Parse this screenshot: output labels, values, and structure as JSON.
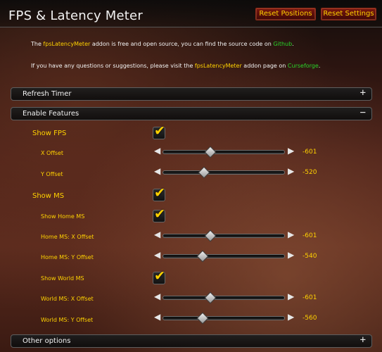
{
  "header": {
    "title": "FPS & Latency Meter",
    "reset_positions_label": "Reset Positions",
    "reset_settings_label": "Reset Settings"
  },
  "intro": {
    "line1_pre": "The ",
    "line1_addon": "fpsLatencyMeter",
    "line1_mid": " addon is free and open source, you can find the source code on ",
    "line1_link": "Github",
    "line1_end": ".",
    "line2_pre": "If you have any questions or suggestions, please visit the ",
    "line2_addon": "fpsLatencyMeter",
    "line2_mid": " addon page on ",
    "line2_link": "Curseforge",
    "line2_end": "."
  },
  "sections": {
    "refresh_timer": {
      "label": "Refresh Timer",
      "toggle": "+"
    },
    "enable_features": {
      "label": "Enable Features",
      "toggle": "−"
    },
    "other_options": {
      "label": "Other options",
      "toggle": "+"
    }
  },
  "options": {
    "show_fps": {
      "label": "Show FPS",
      "checked": true
    },
    "fps_x_offset": {
      "label": "X Offset",
      "value": "-601",
      "fraction": 0.39
    },
    "fps_y_offset": {
      "label": "Y Offset",
      "value": "-520",
      "fraction": 0.34
    },
    "show_ms": {
      "label": "Show MS",
      "checked": true
    },
    "show_home_ms": {
      "label": "Show Home MS",
      "checked": true
    },
    "home_ms_x_offset": {
      "label": "Home MS: X Offset",
      "value": "-601",
      "fraction": 0.39
    },
    "home_ms_y_offset": {
      "label": "Home MS: Y Offset",
      "value": "-540",
      "fraction": 0.33
    },
    "show_world_ms": {
      "label": "Show World MS",
      "checked": true
    },
    "world_ms_x_offset": {
      "label": "World MS: X Offset",
      "value": "-601",
      "fraction": 0.39
    },
    "world_ms_y_offset": {
      "label": "World MS: Y Offset",
      "value": "-560",
      "fraction": 0.33
    }
  },
  "icons": {
    "check": "✔",
    "arrow_left": "◀",
    "arrow_right": "▶"
  },
  "colors": {
    "gold": "#ffd200",
    "link_green": "#29d329",
    "button_red": "#7a160e"
  }
}
